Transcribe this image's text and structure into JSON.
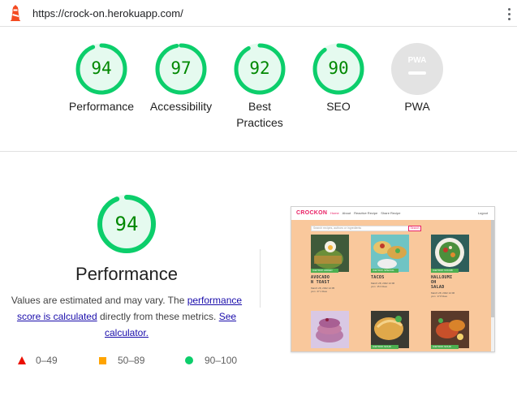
{
  "browser": {
    "url": "https://crock-on.herokuapp.com/"
  },
  "scores": [
    {
      "value": "94",
      "label": "Performance",
      "score": 0.94
    },
    {
      "value": "97",
      "label": "Accessibility",
      "score": 0.97
    },
    {
      "value": "92",
      "label": "Best Practices",
      "score": 0.92
    },
    {
      "value": "90",
      "label": "SEO",
      "score": 0.9
    },
    {
      "value": "PWA",
      "label": "PWA",
      "score": null
    }
  ],
  "performance": {
    "score": "94",
    "title": "Performance",
    "desc_prefix": "Values are estimated and may vary. The ",
    "desc_link1": "performance score is calculated",
    "desc_mid": " directly from these metrics. ",
    "desc_link2": "See calculator."
  },
  "legend": {
    "fail": "0–49",
    "average": "50–89",
    "pass": "90–100"
  },
  "colors": {
    "pass": "#0cce6b",
    "pass_text": "#008800",
    "average": "#ffa400",
    "fail": "#eb0f00",
    "neutral": "#e0e0e0",
    "thumb_bg": "#f9c89c",
    "brand": "#e91e63"
  },
  "thumbnail": {
    "brand": "CROCKON",
    "nav": [
      "Home",
      "About",
      "Reactive Recipe",
      "Share Recipe"
    ],
    "logout": "Logout",
    "search_placeholder": "Search recipes, authors or ingredients",
    "search_button": "Search",
    "cards": [
      {
        "tag": "ICETROK ADDED",
        "title": "AVOCADO\nN TOAST",
        "meta": "March 28, 2022 12:05\nyum  27.1 likes"
      },
      {
        "tag": "ICETROK SPECIAL",
        "title": "TACOS",
        "meta": "March 28, 2022 12:06\nyum  15.3 likes"
      },
      {
        "tag": "ICETROK VOCAB",
        "title": "HALLOUMI\nOH\nSALAD",
        "meta": "March 28, 2022 12:06\nyum  17.8 likes"
      },
      {
        "tag": "",
        "title": "",
        "meta": ""
      },
      {
        "tag": "ICETROK SOUR",
        "title": "",
        "meta": ""
      },
      {
        "tag": "ICETROK SOUR",
        "title": "",
        "meta": ""
      }
    ]
  }
}
